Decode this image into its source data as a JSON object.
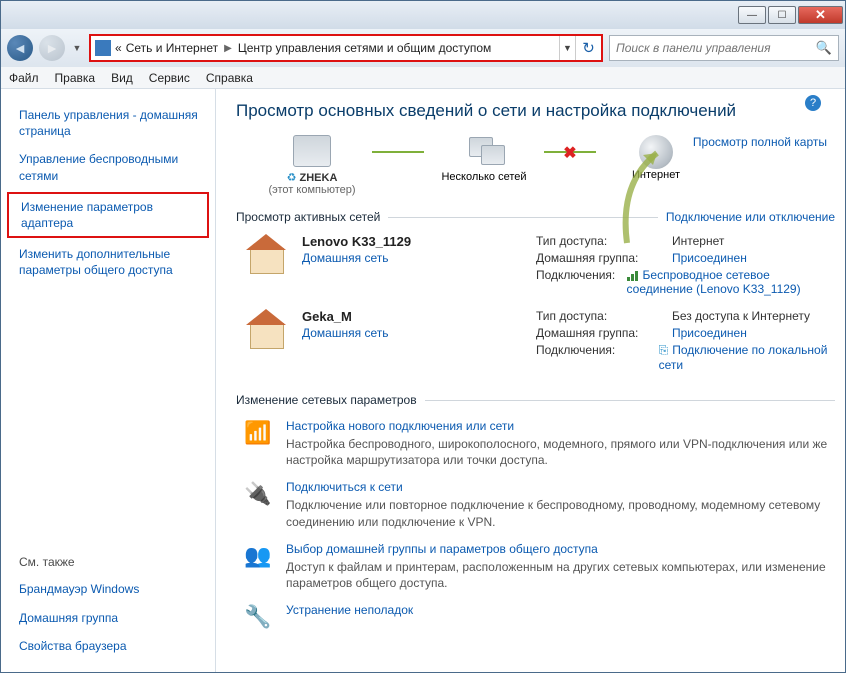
{
  "titlebar": {},
  "breadcrumb": {
    "prev_indicator": "«",
    "level1": "Сеть и Интернет",
    "level2": "Центр управления сетями и общим доступом"
  },
  "search": {
    "placeholder": "Поиск в панели управления"
  },
  "menu": {
    "file": "Файл",
    "edit": "Правка",
    "view": "Вид",
    "tools": "Сервис",
    "help": "Справка"
  },
  "sidebar": {
    "home": "Панель управления - домашняя страница",
    "wireless": "Управление беспроводными сетями",
    "adapter": "Изменение параметров адаптера",
    "sharing": "Изменить дополнительные параметры общего доступа",
    "seealso": "См. также",
    "firewall": "Брандмауэр Windows",
    "homegroup": "Домашняя группа",
    "browser": "Свойства браузера"
  },
  "main_title": "Просмотр основных сведений о сети и настройка подключений",
  "map": {
    "full_map": "Просмотр полной карты",
    "pc_name": "ZHEKA",
    "pc_sub": "(этот компьютер)",
    "multi": "Несколько сетей",
    "internet": "Интернет"
  },
  "active_head": "Просмотр активных сетей",
  "active_right": "Подключение или отключение",
  "labels": {
    "access": "Тип доступа:",
    "homegroup": "Домашняя группа:",
    "conn": "Подключения:"
  },
  "net1": {
    "name": "Lenovo K33_1129",
    "type": "Домашняя сеть",
    "access": "Интернет",
    "hg": "Присоединен",
    "conn": "Беспроводное сетевое соединение (Lenovo K33_1129)"
  },
  "net2": {
    "name": "Geka_M",
    "type": "Домашняя сеть",
    "access": "Без доступа к Интернету",
    "hg": "Присоединен",
    "conn": "Подключение по локальной сети"
  },
  "change_head": "Изменение сетевых параметров",
  "c1": {
    "title": "Настройка нового подключения или сети",
    "desc": "Настройка беспроводного, широкополосного, модемного, прямого или VPN-подключения или же настройка маршрутизатора или точки доступа."
  },
  "c2": {
    "title": "Подключиться к сети",
    "desc": "Подключение или повторное подключение к беспроводному, проводному, модемному сетевому соединению или подключение к VPN."
  },
  "c3": {
    "title": "Выбор домашней группы и параметров общего доступа",
    "desc": "Доступ к файлам и принтерам, расположенным на других сетевых компьютерах, или изменение параметров общего доступа."
  },
  "c4": {
    "title": "Устранение неполадок"
  }
}
